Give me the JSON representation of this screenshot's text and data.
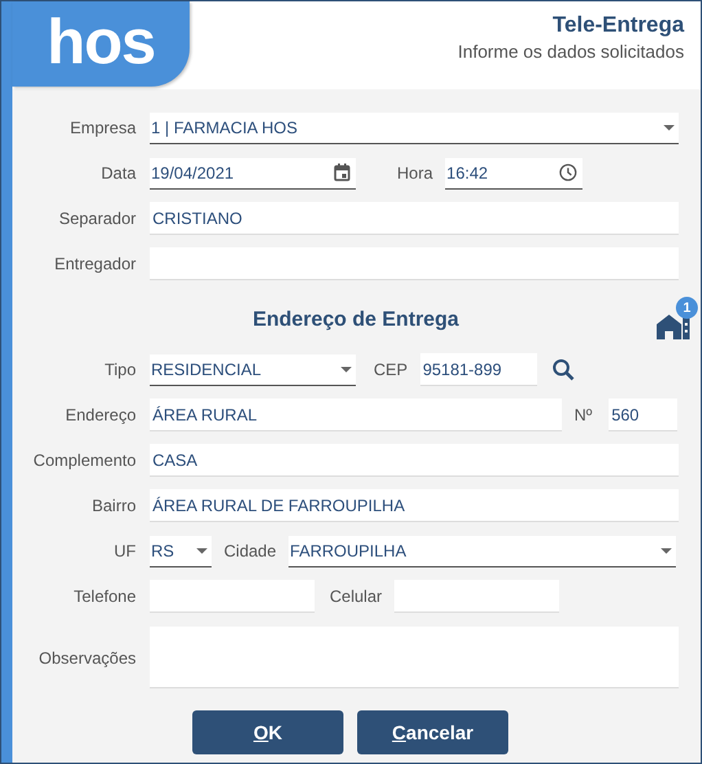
{
  "header": {
    "logo": "hos",
    "title": "Tele-Entrega",
    "subtitle": "Informe os dados solicitados"
  },
  "empresa": {
    "label": "Empresa",
    "value": "1 | FARMACIA HOS"
  },
  "data": {
    "label": "Data",
    "value": "19/04/2021"
  },
  "hora": {
    "label": "Hora",
    "value": "16:42"
  },
  "separador": {
    "label": "Separador",
    "value": "CRISTIANO"
  },
  "entregador": {
    "label": "Entregador"
  },
  "address_section": {
    "title": "Endereço de Entrega",
    "badge": "1"
  },
  "tipo": {
    "label": "Tipo",
    "value": "RESIDENCIAL"
  },
  "cep": {
    "label": "CEP",
    "value": "95181-899"
  },
  "endereco": {
    "label": "Endereço",
    "value": "ÁREA RURAL"
  },
  "numero": {
    "label": "Nº",
    "value": "560"
  },
  "complemento": {
    "label": "Complemento",
    "value": "CASA"
  },
  "bairro": {
    "label": "Bairro",
    "value": "ÁREA RURAL DE FARROUPILHA"
  },
  "uf": {
    "label": "UF",
    "value": "RS"
  },
  "cidade": {
    "label": "Cidade",
    "value": "FARROUPILHA"
  },
  "telefone": {
    "label": "Telefone"
  },
  "celular": {
    "label": "Celular"
  },
  "observacoes": {
    "label": "Observações"
  },
  "buttons": [
    {
      "accel": "O",
      "rest": "K"
    },
    {
      "accel": "C",
      "rest": "ancelar"
    }
  ]
}
